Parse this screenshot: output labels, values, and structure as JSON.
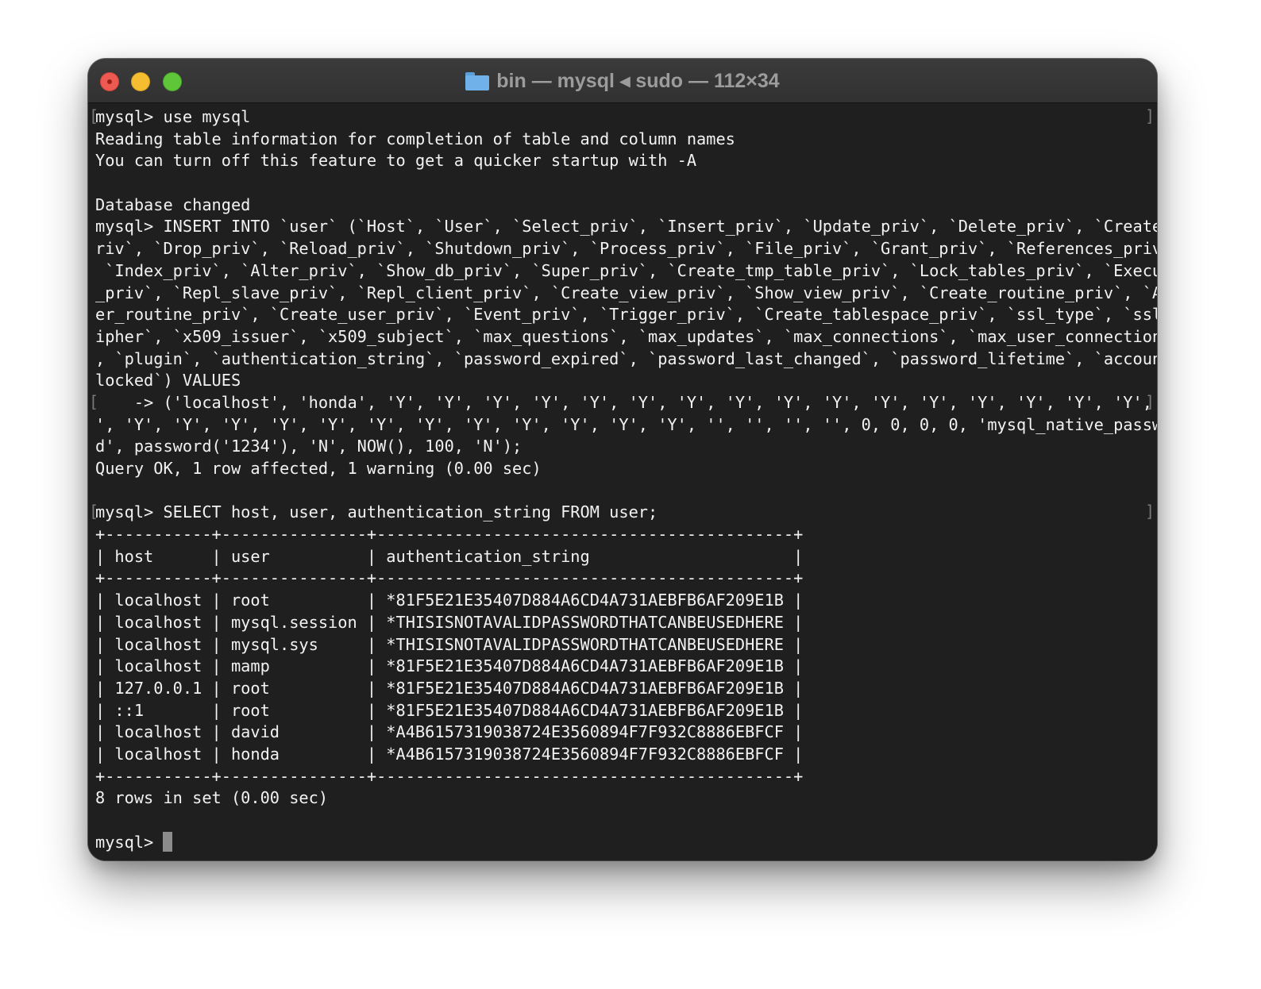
{
  "window": {
    "title": "bin — mysql ◂ sudo — 112×34"
  },
  "icons": {
    "folder": "folder-icon",
    "close": "close-icon",
    "minimize": "minimize-icon",
    "maximize": "maximize-icon"
  },
  "colors": {
    "terminal_bg": "#1f1f1f",
    "text": "#f2f2f2",
    "close": "#ee5a52",
    "minimize": "#f5be30",
    "maximize": "#5fc639"
  },
  "terminal": {
    "lines": [
      "mysql> use mysql",
      "Reading table information for completion of table and column names",
      "You can turn off this feature to get a quicker startup with -A",
      "",
      "Database changed",
      "mysql> INSERT INTO `user` (`Host`, `User`, `Select_priv`, `Insert_priv`, `Update_priv`, `Delete_priv`, `Create_p",
      "riv`, `Drop_priv`, `Reload_priv`, `Shutdown_priv`, `Process_priv`, `File_priv`, `Grant_priv`, `References_priv`,",
      " `Index_priv`, `Alter_priv`, `Show_db_priv`, `Super_priv`, `Create_tmp_table_priv`, `Lock_tables_priv`, `Execute",
      "_priv`, `Repl_slave_priv`, `Repl_client_priv`, `Create_view_priv`, `Show_view_priv`, `Create_routine_priv`, `Alt",
      "er_routine_priv`, `Create_user_priv`, `Event_priv`, `Trigger_priv`, `Create_tablespace_priv`, `ssl_type`, `ssl_c",
      "ipher`, `x509_issuer`, `x509_subject`, `max_questions`, `max_updates`, `max_connections`, `max_user_connections`",
      ", `plugin`, `authentication_string`, `password_expired`, `password_last_changed`, `password_lifetime`, `account_",
      "locked`) VALUES",
      "    -> ('localhost', 'honda', 'Y', 'Y', 'Y', 'Y', 'Y', 'Y', 'Y', 'Y', 'Y', 'Y', 'Y', 'Y', 'Y', 'Y', 'Y', 'Y', 'Y",
      "', 'Y', 'Y', 'Y', 'Y', 'Y', 'Y', 'Y', 'Y', 'Y', 'Y', 'Y', 'Y', '', '', '', '', 0, 0, 0, 0, 'mysql_native_passwor",
      "d', password('1234'), 'N', NOW(), 100, 'N');",
      "Query OK, 1 row affected, 1 warning (0.00 sec)",
      "",
      "mysql> SELECT host, user, authentication_string FROM user;",
      "+-----------+---------------+-------------------------------------------+",
      "| host      | user          | authentication_string                     |",
      "+-----------+---------------+-------------------------------------------+",
      "| localhost | root          | *81F5E21E35407D884A6CD4A731AEBFB6AF209E1B |",
      "| localhost | mysql.session | *THISISNOTAVALIDPASSWORDTHATCANBEUSEDHERE |",
      "| localhost | mysql.sys     | *THISISNOTAVALIDPASSWORDTHATCANBEUSEDHERE |",
      "| localhost | mamp          | *81F5E21E35407D884A6CD4A731AEBFB6AF209E1B |",
      "| 127.0.0.1 | root          | *81F5E21E35407D884A6CD4A731AEBFB6AF209E1B |",
      "| ::1       | root          | *81F5E21E35407D884A6CD4A731AEBFB6AF209E1B |",
      "| localhost | david         | *A4B6157319038724E3560894F7F932C8886EBFCF |",
      "| localhost | honda         | *A4B6157319038724E3560894F7F932C8886EBFCF |",
      "+-----------+---------------+-------------------------------------------+",
      "8 rows in set (0.00 sec)",
      ""
    ],
    "prompt": "mysql> "
  }
}
